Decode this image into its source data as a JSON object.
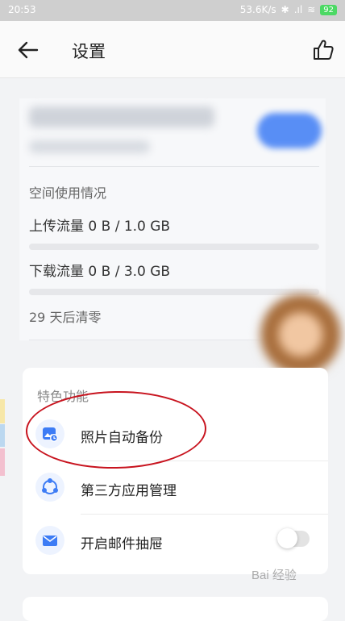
{
  "status_bar": {
    "time": "20:53",
    "network": "53.6K/s",
    "battery": "92"
  },
  "header": {
    "title": "设置"
  },
  "account": {
    "space_title": "空间使用情况",
    "upload_label": "上传流量 0 B / 1.0 GB",
    "upload_fraction": 0,
    "download_label": "下载流量 0 B / 3.0 GB",
    "download_fraction": 0,
    "reset_text": "29 天后清零"
  },
  "features": {
    "title": "特色功能",
    "items": [
      {
        "label": "照片自动备份",
        "icon": "photo-backup-icon"
      },
      {
        "label": "第三方应用管理",
        "icon": "app-manage-icon"
      },
      {
        "label": "开启邮件抽屉",
        "icon": "mail-icon",
        "toggle_on": false
      }
    ]
  },
  "colors": {
    "accent": "#3d7cf5",
    "annotation": "#c8141f"
  },
  "watermark": "Bai 经验"
}
